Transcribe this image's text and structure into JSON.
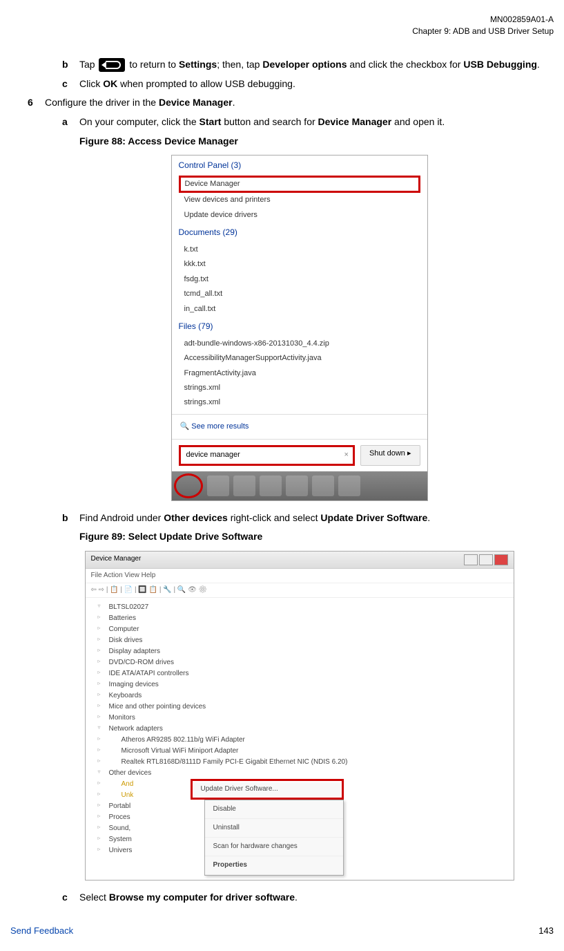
{
  "header": {
    "doc_id": "MN002859A01-A",
    "chapter": "Chapter 9:  ADB and USB Driver Setup"
  },
  "steps": {
    "b_tap_prefix": "Tap ",
    "b_tap_suffix": " to return to ",
    "settings": "Settings",
    "b_tap_mid": "; then, tap ",
    "dev_options": "Developer options",
    "b_tap_end": " and click the checkbox for ",
    "usb_debugging": "USB Debugging",
    "period": ".",
    "c_text": "Click ",
    "ok": "OK",
    "c_end": " when prompted to allow USB debugging.",
    "step6": "Configure the driver in the ",
    "device_manager": "Device Manager",
    "a6_text": "On your computer, click the ",
    "start": "Start",
    "a6_mid": " button and search for ",
    "a6_end": " and open it.",
    "fig88": "Figure 88: Access Device Manager",
    "b6_text": "Find Android under ",
    "other_devices": "Other devices",
    "b6_mid": " right-click and select ",
    "update_driver": "Update Driver Software",
    "fig89": "Figure 89: Select Update Drive Software",
    "c6_text": "Select ",
    "browse": "Browse my computer for driver software"
  },
  "screenshot1": {
    "control_panel": "Control Panel (3)",
    "device_manager": "Device Manager",
    "view_devices": "View devices and printers",
    "update_drivers": "Update device drivers",
    "documents": "Documents (29)",
    "doc1": "k.txt",
    "doc2": "kkk.txt",
    "doc3": "fsdg.txt",
    "doc4": "tcmd_all.txt",
    "doc5": "in_call.txt",
    "files": "Files (79)",
    "file1": "adt-bundle-windows-x86-20131030_4.4.zip",
    "file2": "AccessibilityManagerSupportActivity.java",
    "file3": "FragmentActivity.java",
    "file4": "strings.xml",
    "file5": "strings.xml",
    "see_more": "See more results",
    "search_value": "device manager",
    "shutdown": "Shut down"
  },
  "screenshot2": {
    "title": "Device Manager",
    "menu": "File    Action    View    Help",
    "root": "BLTSL02027",
    "items": {
      "batteries": "Batteries",
      "computer": "Computer",
      "disk": "Disk drives",
      "display": "Display adapters",
      "dvd": "DVD/CD-ROM drives",
      "ide": "IDE ATA/ATAPI controllers",
      "imaging": "Imaging devices",
      "keyboards": "Keyboards",
      "mice": "Mice and other pointing devices",
      "monitors": "Monitors",
      "network": "Network adapters",
      "net1": "Atheros AR9285 802.11b/g WiFi Adapter",
      "net2": "Microsoft Virtual WiFi Miniport Adapter",
      "net3": "Realtek RTL8168D/8111D Family PCI-E Gigabit Ethernet NIC (NDIS 6.20)",
      "other": "Other devices",
      "android": "And",
      "unknown": "Unk",
      "portable": "Portabl",
      "processors": "Proces",
      "sound": "Sound,",
      "system": "System",
      "universal": "Univers"
    },
    "context": {
      "update": "Update Driver Software...",
      "disable": "Disable",
      "uninstall": "Uninstall",
      "scan": "Scan for hardware changes",
      "properties": "Properties"
    }
  },
  "footer": {
    "send_feedback": "Send Feedback",
    "page": "143"
  }
}
